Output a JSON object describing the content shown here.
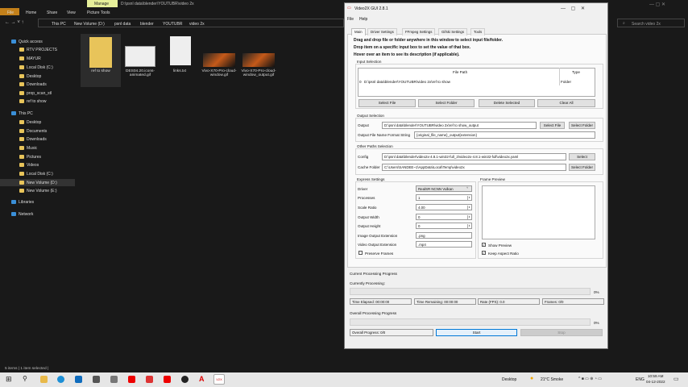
{
  "explorer": {
    "ribbon_context": "Manage",
    "title_path": "D:\\psnl data\\blender\\YOUTUBR\\video 2x",
    "ribbon_tabs": [
      "File",
      "Home",
      "Share",
      "View",
      "Picture Tools"
    ],
    "breadcrumb": [
      "This PC",
      "New Volume (D:)",
      "psnl data",
      "blender",
      "YOUTUBR",
      "video 2x"
    ],
    "search_placeholder": "Search video 2x",
    "nav": [
      {
        "label": "Quick access",
        "level": 0
      },
      {
        "label": "RTV PROJECTS",
        "level": 1
      },
      {
        "label": "MAYUR",
        "level": 1
      },
      {
        "label": "Local Disk (C:)",
        "level": 1
      },
      {
        "label": "Desktop",
        "level": 1
      },
      {
        "label": "Downloads",
        "level": 1
      },
      {
        "label": "prop_scan_stl",
        "level": 1
      },
      {
        "label": "ref to show",
        "level": 1
      },
      {
        "label": "This PC",
        "level": 0
      },
      {
        "label": "Desktop",
        "level": 1
      },
      {
        "label": "Documents",
        "level": 1
      },
      {
        "label": "Downloads",
        "level": 1
      },
      {
        "label": "Music",
        "level": 1
      },
      {
        "label": "Pictures",
        "level": 1
      },
      {
        "label": "Videos",
        "level": 1
      },
      {
        "label": "Local Disk (C:)",
        "level": 1
      },
      {
        "label": "New Volume (D:)",
        "level": 1,
        "selected": true
      },
      {
        "label": "New Volume (E:)",
        "level": 1
      },
      {
        "label": "Libraries",
        "level": 0
      },
      {
        "label": "Network",
        "level": 0
      }
    ],
    "files": [
      {
        "name": "ref to show",
        "kind": "folder"
      },
      {
        "name": "DES04.20.icons-animated.gif",
        "kind": "image"
      },
      {
        "name": "links.txt",
        "kind": "text"
      },
      {
        "name": "Vivo-X70-Pro-cloud-window.gif",
        "kind": "photo"
      },
      {
        "name": "Vivo-X70-Pro-cloud-window_output.gif",
        "kind": "photo"
      }
    ],
    "status": "5 items  |  1 item selected  |"
  },
  "app": {
    "title": "Video2X GUI 2.8.1",
    "menu": [
      "File",
      "Help"
    ],
    "tabs": [
      "Main",
      "Driver Settings",
      "FFmpeg Settings",
      "Gifski Settings",
      "Tools"
    ],
    "instructions": [
      "Drag and drop file or folder anywhere in this window to select input file/folder.",
      "Drop item on a specific input box to set the value of that box.",
      "Hover over an item to see its description (if applicable)."
    ],
    "input": {
      "group": "Input Selection",
      "col_path": "File Path",
      "col_type": "Type",
      "rows": [
        {
          "index": "0",
          "path": "D:\\psnl data\\blender\\YOUTUBR\\video 2x\\ref to show",
          "type": "Folder"
        }
      ],
      "buttons": [
        "Select File",
        "Select Folder",
        "Delete Selected",
        "Clear All"
      ]
    },
    "output": {
      "group": "Output Selection",
      "label": "Output",
      "value": "D:\\psnl data\\blender\\YOUTUBR\\video 2x\\ref to show_output",
      "select_file": "Select File",
      "select_folder": "Select Folder",
      "format_label": "Output File Name Format String",
      "format_value": "{original_file_name}_output{extension}"
    },
    "paths": {
      "group": "Other Paths Selection",
      "config_label": "Config",
      "config_value": "D:\\psnl data\\blender\\video2x-4.8.1-win32-full_2\\video2x-4.8.1-win32-full\\video2x.yaml",
      "config_button": "Select",
      "cache_label": "Cache Folder",
      "cache_value": "C:\\Users\\SANDEE~1\\AppData\\Local\\Temp\\video2x",
      "cache_button": "Select Folder"
    },
    "express": {
      "group": "Express Settings",
      "driver_label": "Driver",
      "driver": "RealSR NCNN Vulkan",
      "processes_label": "Processes",
      "processes": "1",
      "scale_label": "Scale Ratio",
      "scale": "4.00",
      "width_label": "Output Width",
      "width": "0",
      "height_label": "Output Height",
      "height": "0",
      "image_ext_label": "Image Output Extension",
      "image_ext": ".png",
      "video_ext_label": "Video Output Extension",
      "video_ext": ".mp4",
      "preserve_frames": "Preserve Frames"
    },
    "preview": {
      "group": "Frame Preview",
      "show_preview": "Show Preview",
      "keep_aspect": "Keep Aspect Ratio"
    },
    "progress": {
      "group": "Current Processing Progress",
      "currently": "Currently Processing:",
      "percent": "0%",
      "elapsed": "Time Elapsed: 00:00:00",
      "remaining": "Time Remaining: 00:00:00",
      "rate": "Rate (FPS): 0.0",
      "frames": "Frames: 0/0",
      "overall_group": "Overall Processing Progress",
      "overall_percent": "0%",
      "overall": "Overall Progress: 0/0",
      "start": "Start",
      "stop": "Stop",
      "current_value": 0,
      "overall_value": 0
    }
  },
  "taskbar": {
    "desktop": "Desktop",
    "weather": "21°C  Smoke",
    "lang": "ENG",
    "time": "10:59 AM",
    "date": "04-12-2022"
  }
}
